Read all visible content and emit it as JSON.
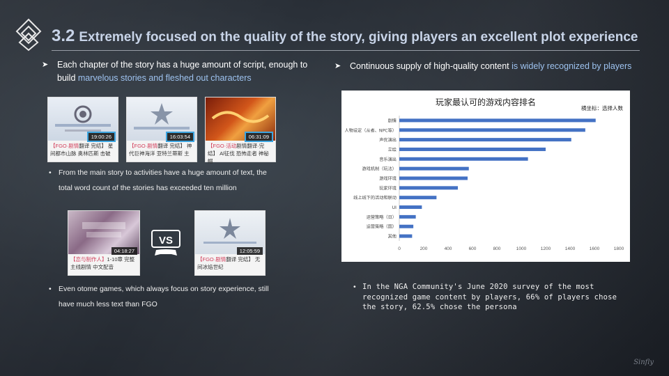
{
  "slide": {
    "number": "3.2",
    "title": "Extremely focused on the quality of the story, giving players an excellent plot experience"
  },
  "left": {
    "bullet_plain": "Each chapter of the story has a huge amount of script, enough to build ",
    "bullet_highlight": "marvelous stories and fleshed out characters",
    "sub1": "From the main story to activities have a huge amount of text, the total word count of the stories has exceeded ten million",
    "sub2": "Even otome games, which always focus on story experience, still have much less text than FGO",
    "thumbs": [
      {
        "duration": "19:00:26",
        "cap_red": "【FGO·剧情",
        "cap_rest": "翻译 完结】 星间都市山脉 奥林匹斯 击破"
      },
      {
        "duration": "16:03:54",
        "cap_red": "【FGO·剧情",
        "cap_rest": "翻译 完结】 神代巨神海洋 亚特兰蒂斯 主"
      },
      {
        "duration": "06:31:09",
        "cap_red": "【FGO·活动",
        "cap_rest": "剧情翻译·完结】 Al征伐 恐怖走者 神秘帽"
      },
      {
        "duration": "04:18:27",
        "cap_red": "【恋与制作人】",
        "cap_rest": "1-10章 完整主线剧情 中文配音"
      },
      {
        "duration": "12:05:59",
        "cap_red": "【FGO·剧情",
        "cap_rest": "翻译 完结】 无间冰焰世纪"
      }
    ],
    "vs_label": "VS"
  },
  "right": {
    "bullet_plain": "Continuous supply of high-quality content ",
    "bullet_highlight": "is widely recognized by players",
    "caption": "In the NGA Community's June 2020 survey of the most recognized game content by players, 66% of players chose the story, 62.5% chose the persona"
  },
  "signature": "Sinfly",
  "chart_data": {
    "type": "bar",
    "orientation": "horizontal",
    "title": "玩家最认可的游戏内容排名",
    "note": "横坐标：选择人数",
    "categories": [
      "剧情",
      "人物设定（从者、NPC等）",
      "声优演出",
      "立绘",
      "音乐演出",
      "游戏机制（玩法）",
      "游戏环境",
      "玩家环境",
      "线上线下的活动和联动",
      "UI",
      "运营策略（日）",
      "运营策略（国）",
      "其他"
    ],
    "values": [
      1610,
      1525,
      1410,
      1200,
      1055,
      570,
      560,
      480,
      305,
      185,
      135,
      115,
      105
    ],
    "xlim": [
      0,
      1800
    ],
    "xticks": [
      0,
      200,
      400,
      600,
      800,
      1000,
      1200,
      1400,
      1600,
      1800
    ],
    "bar_color": "#4472c4"
  }
}
